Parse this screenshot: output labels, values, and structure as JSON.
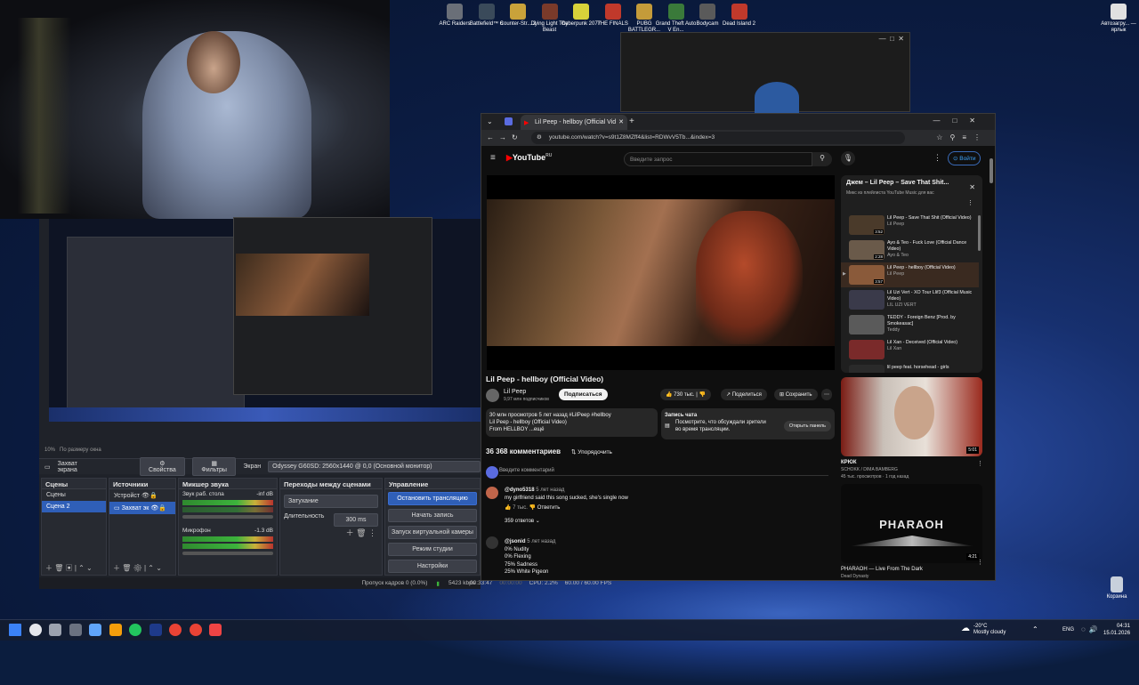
{
  "desktop_icons": [
    {
      "label": "ARC Raiders",
      "color": "#6a6f78"
    },
    {
      "label": "Battlefield™ 6",
      "color": "#3a4a5a"
    },
    {
      "label": "Counter-Str... 2",
      "color": "#c9a23a"
    },
    {
      "label": "Dying Light The Beast",
      "color": "#7a3a2a"
    },
    {
      "label": "Cyberpunk 2077",
      "color": "#d8d23a"
    },
    {
      "label": "THE FINALS",
      "color": "#c0392b"
    },
    {
      "label": "PUBG BATTLEGR...",
      "color": "#c49b3a"
    },
    {
      "label": "Grand Theft Auto V En...",
      "color": "#3a7a3a"
    },
    {
      "label": "Bodycam",
      "color": "#5a5a5a"
    },
    {
      "label": "Dead Island 2",
      "color": "#c0392b"
    }
  ],
  "right_icon": "Автозагру... — ярлык",
  "recycle": "Корзина",
  "obs": {
    "zoom": "10%",
    "zoom_fit": "По размеру окна",
    "source_label": "Захват экрана",
    "props": "Свойства",
    "filters": "Фильтры",
    "screen": "Экран",
    "monitor": "Odyssey G60SD: 2560x1440 @ 0,0 (Основной монитор)",
    "scenes_title": "Сцены",
    "scenes": [
      "Сцены",
      "Сцена 2"
    ],
    "sources_title": "Источники",
    "sources": [
      "Устройст",
      "Захват эк"
    ],
    "mixer_title": "Микшер звука",
    "mixer": [
      {
        "name": "Звук раб. стола",
        "db": "-inf dB"
      },
      {
        "name": "Микрофон",
        "db": "-1.3 dB"
      }
    ],
    "trans_title": "Переходы между сценами",
    "trans_type": "Затухание",
    "dur_label": "Длительность",
    "dur_value": "300 ms",
    "ctrl_title": "Управление",
    "controls": [
      "Остановить трансляцию",
      "Начать запись",
      "Запуск виртуальной камеры",
      "Режим студии",
      "Настройки"
    ],
    "status": {
      "dropped": "Пропуск кадров 0 (0.0%)",
      "kbps": "5423 kbps",
      "live": "00:33:47",
      "rec": "00:00:00",
      "cpu": "CPU: 2.2%",
      "fps": "60.00 / 60.00 FPS"
    }
  },
  "chrome": {
    "tab_title": "Lil Peep - hellboy (Official Vid",
    "url": "youtube.com/watch?v=s9t1Z8MZff4&list=RDWvV5Tb...&index=3",
    "search_placeholder": "Введите запрос",
    "signin": "Войти",
    "yt_logo": "YouTube",
    "yt_region": "RU"
  },
  "video": {
    "title": "Lil Peep - hellboy (Official Video)",
    "channel": "Lil Peep",
    "subs": "9,97 млн подписчиков",
    "subscribe": "Подписаться",
    "likes": "730 тыс.",
    "share": "Поделиться",
    "save": "Сохранить",
    "desc_line1": "30 млн просмотров  5 лет назад  #LilPeep #hellboy",
    "desc_line2": "Lil Peep - hellboy (Official Video)",
    "desc_line3": "From HELLBOY ...ещё",
    "chat_title": "Запись чата",
    "chat_text": "Посмотрите, что обсуждали зрители во время трансляции.",
    "chat_btn": "Открыть панель",
    "comments_count": "36 368 комментариев",
    "sort": "Упорядочить",
    "add_comment": "Введите комментарий",
    "comments": [
      {
        "author": "@dyno5318",
        "time": "5 лет назад",
        "text": "my girlfriend said this song sucked, she's single now",
        "likes": "7 тыс.",
        "reply": "Ответить",
        "replies": "359 ответов"
      },
      {
        "author": "@jsonid",
        "time": "5 лет назад",
        "lines": [
          "0% Nudity",
          "0% Flexing",
          "75% Sadness",
          "25% White Pigeon"
        ]
      }
    ]
  },
  "playlist": {
    "title": "Джем – Lil Peep – Save That Shit...",
    "sub": "Микс из плейлиста YouTube Music для вас",
    "items": [
      {
        "title": "Lil Peep - Save That Shit (Official Video)",
        "channel": "Lil Peep",
        "dur": "3:52",
        "color": "#4a3a2a"
      },
      {
        "title": "Ayo & Teo - Fuck Love (Official Dance Video)",
        "channel": "Ayo & Teo",
        "dur": "2:28",
        "color": "#6a5a4a"
      },
      {
        "title": "Lil Peep - hellboy (Official Video)",
        "channel": "Lil Peep",
        "dur": "3:57",
        "color": "#8a5a3a",
        "active": true
      },
      {
        "title": "Lil Uzi Vert - XO Tour Llif3 (Official Music Video)",
        "channel": "LIL UZI VERT",
        "dur": "",
        "color": "#3a3a4a"
      },
      {
        "title": "TEDDY - Foreign Benz [Prod. by Smokeasac]",
        "channel": "Teddy",
        "dur": "",
        "color": "#5a5a5a"
      },
      {
        "title": "Lil Xan - Deceived (Official Video)",
        "channel": "Lil Xan",
        "dur": "",
        "color": "#7a2a2a"
      },
      {
        "title": "lil peep feat. horsehead - girls",
        "channel": "",
        "dur": "",
        "color": "#2a2a2a"
      }
    ]
  },
  "recs": [
    {
      "title": "КРЮК",
      "channel": "SCHOKK / DIMA BAMBERG",
      "meta": "45 тыс. просмотров · 1 год назад",
      "dur": "5:01"
    },
    {
      "title": "PHARAOH — Live From The Dark",
      "channel": "Dead Dynasty",
      "meta": "",
      "dur": "4:21",
      "logo": "PHARAOH"
    }
  ],
  "taskbar": {
    "weather_temp": "-20°C",
    "weather": "Mostly cloudy",
    "lang": "ENG",
    "time": "04:31",
    "date": "15.01.2026"
  }
}
